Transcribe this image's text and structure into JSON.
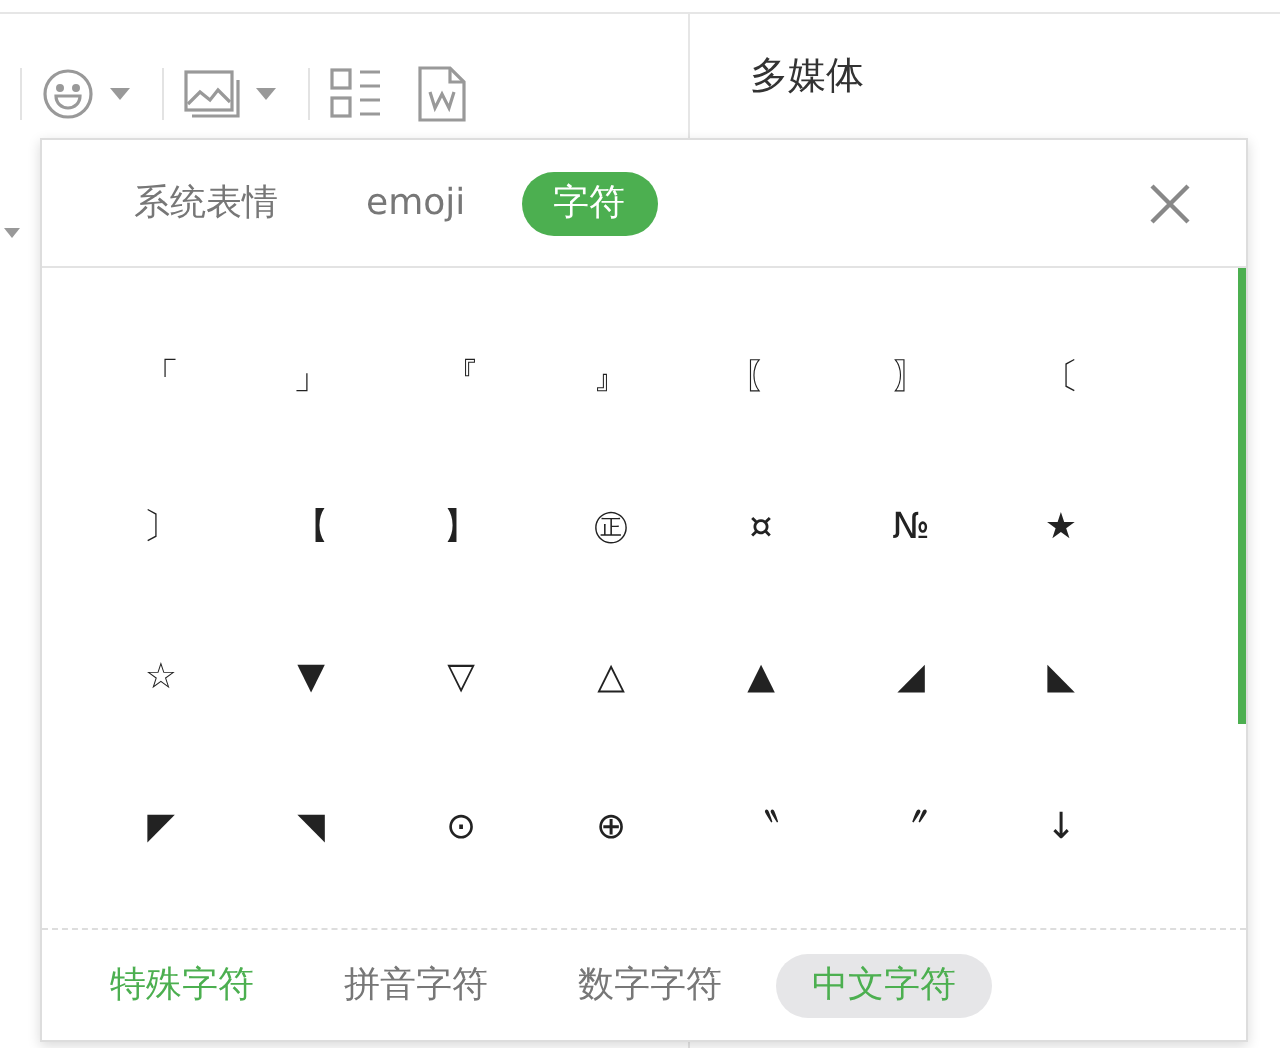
{
  "toolbar": {
    "buttons": [
      {
        "kind": "emoji",
        "has_menu": true
      },
      {
        "kind": "image",
        "has_menu": true
      },
      {
        "kind": "layout",
        "has_menu": false
      },
      {
        "kind": "word",
        "has_menu": false
      }
    ]
  },
  "side_panel": {
    "title": "多媒体"
  },
  "symbol_popup": {
    "tabs": [
      {
        "label": "系统表情",
        "selected": false
      },
      {
        "label": "emoji",
        "selected": false
      },
      {
        "label": "字符",
        "selected": true
      }
    ],
    "characters": [
      "「",
      "」",
      "『",
      "』",
      "〖",
      "〗",
      "〔",
      "〕",
      "【",
      "】",
      "㊣",
      "¤",
      "№",
      "★",
      "☆",
      "▼",
      "▽",
      "△",
      "▲",
      "◢",
      "◣",
      "◤",
      "◥",
      "⊙",
      "⊕",
      "〝",
      "〞",
      "↓"
    ],
    "categories": [
      {
        "label": "特殊字符",
        "active": true,
        "highlighted": false
      },
      {
        "label": "拼音字符",
        "active": false,
        "highlighted": false
      },
      {
        "label": "数字字符",
        "active": false,
        "highlighted": false
      },
      {
        "label": "中文字符",
        "active": true,
        "highlighted": true
      }
    ]
  }
}
